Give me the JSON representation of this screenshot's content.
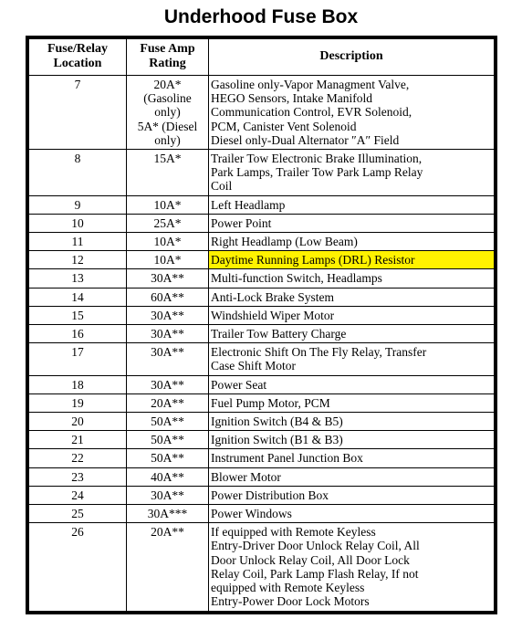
{
  "document": {
    "title": "Underhood Fuse Box"
  },
  "table": {
    "headers": {
      "location": {
        "line1": "Fuse/Relay",
        "line2": "Location"
      },
      "amp": {
        "line1": "Fuse Amp",
        "line2": "Rating"
      },
      "description": {
        "line1": "Description",
        "line2": ""
      }
    },
    "highlight_color": "#FFF200",
    "rows": [
      {
        "location": "7",
        "amp_lines": [
          "20A*",
          "(Gasoline",
          "only)",
          "5A* (Diesel",
          "only)"
        ],
        "desc_lines": [
          "Gasoline only-Vapor Managment Valve,",
          "HEGO Sensors, Intake Manifold",
          "Communication Control, EVR Solenoid,",
          "PCM, Canister Vent Solenoid",
          "Diesel only-Dual Alternator ″A″ Field"
        ],
        "highlighted": false
      },
      {
        "location": "8",
        "amp_lines": [
          "15A*"
        ],
        "desc_lines": [
          "Trailer Tow Electronic Brake Illumination,",
          "Park Lamps, Trailer Tow Park Lamp Relay",
          "Coil"
        ],
        "highlighted": false
      },
      {
        "location": "9",
        "amp_lines": [
          "10A*"
        ],
        "desc_lines": [
          "Left Headlamp"
        ],
        "highlighted": false
      },
      {
        "location": "10",
        "amp_lines": [
          "25A*"
        ],
        "desc_lines": [
          "Power Point"
        ],
        "highlighted": false
      },
      {
        "location": "11",
        "amp_lines": [
          "10A*"
        ],
        "desc_lines": [
          "Right Headlamp (Low Beam)"
        ],
        "highlighted": false
      },
      {
        "location": "12",
        "amp_lines": [
          "10A*"
        ],
        "desc_lines": [
          "Daytime Running Lamps (DRL) Resistor"
        ],
        "highlighted": true
      },
      {
        "location": "13",
        "amp_lines": [
          "30A**"
        ],
        "desc_lines": [
          "Multi-function Switch, Headlamps"
        ],
        "highlighted": false
      },
      {
        "location": "14",
        "amp_lines": [
          "60A**"
        ],
        "desc_lines": [
          "Anti-Lock Brake System"
        ],
        "highlighted": false
      },
      {
        "location": "15",
        "amp_lines": [
          "30A**"
        ],
        "desc_lines": [
          "Windshield Wiper Motor"
        ],
        "highlighted": false
      },
      {
        "location": "16",
        "amp_lines": [
          "30A**"
        ],
        "desc_lines": [
          "Trailer Tow Battery Charge"
        ],
        "highlighted": false
      },
      {
        "location": "17",
        "amp_lines": [
          "30A**"
        ],
        "desc_lines": [
          "Electronic Shift On The Fly Relay, Transfer",
          "Case Shift Motor"
        ],
        "highlighted": false
      },
      {
        "location": "18",
        "amp_lines": [
          "30A**"
        ],
        "desc_lines": [
          "Power Seat"
        ],
        "highlighted": false
      },
      {
        "location": "19",
        "amp_lines": [
          "20A**"
        ],
        "desc_lines": [
          "Fuel Pump Motor, PCM"
        ],
        "highlighted": false
      },
      {
        "location": "20",
        "amp_lines": [
          "50A**"
        ],
        "desc_lines": [
          "Ignition Switch (B4 & B5)"
        ],
        "highlighted": false
      },
      {
        "location": "21",
        "amp_lines": [
          "50A**"
        ],
        "desc_lines": [
          "Ignition Switch (B1 & B3)"
        ],
        "highlighted": false
      },
      {
        "location": "22",
        "amp_lines": [
          "50A**"
        ],
        "desc_lines": [
          "Instrument Panel Junction Box"
        ],
        "highlighted": false
      },
      {
        "location": "23",
        "amp_lines": [
          "40A**"
        ],
        "desc_lines": [
          "Blower Motor"
        ],
        "highlighted": false
      },
      {
        "location": "24",
        "amp_lines": [
          "30A**"
        ],
        "desc_lines": [
          "Power Distribution Box"
        ],
        "highlighted": false
      },
      {
        "location": "25",
        "amp_lines": [
          "30A***"
        ],
        "desc_lines": [
          "Power Windows"
        ],
        "highlighted": false
      },
      {
        "location": "26",
        "amp_lines": [
          "20A**"
        ],
        "desc_lines": [
          "If equipped with Remote Keyless",
          "Entry-Driver Door Unlock Relay Coil, All",
          "Door Unlock Relay Coil, All Door Lock",
          "Relay Coil, Park Lamp Flash Relay, If not",
          "equipped with Remote Keyless",
          "Entry-Power Door Lock Motors"
        ],
        "highlighted": false
      }
    ]
  }
}
